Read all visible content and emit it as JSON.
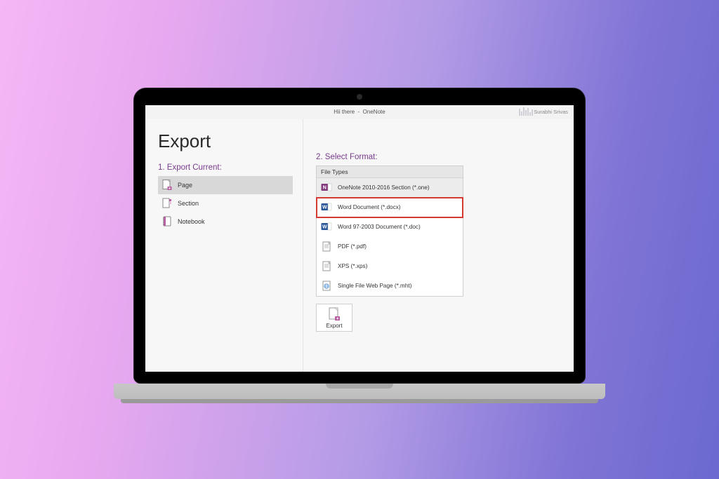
{
  "titlebar": {
    "doc_name": "Hii there",
    "sep": "-",
    "app_name": "OneNote",
    "user_name": "Surabhi Srivas"
  },
  "page_title": "Export",
  "left": {
    "heading": "1. Export Current:",
    "items": [
      {
        "label": "Page",
        "selected": true
      },
      {
        "label": "Section",
        "selected": false
      },
      {
        "label": "Notebook",
        "selected": false
      }
    ]
  },
  "right": {
    "heading": "2. Select Format:",
    "filetypes_header": "File Types",
    "formats": [
      {
        "label": "OneNote 2010-2016 Section (*.one)",
        "icon": "onenote",
        "grey": true,
        "highlight": false
      },
      {
        "label": "Word Document (*.docx)",
        "icon": "word",
        "grey": false,
        "highlight": true
      },
      {
        "label": "Word 97-2003 Document (*.doc)",
        "icon": "word",
        "grey": false,
        "highlight": false
      },
      {
        "label": "PDF (*.pdf)",
        "icon": "doc-plain",
        "grey": false,
        "highlight": false
      },
      {
        "label": "XPS (*.xps)",
        "icon": "doc-plain",
        "grey": false,
        "highlight": false
      },
      {
        "label": "Single File Web Page (*.mht)",
        "icon": "doc-web",
        "grey": false,
        "highlight": false
      }
    ],
    "export_button_label": "Export"
  }
}
